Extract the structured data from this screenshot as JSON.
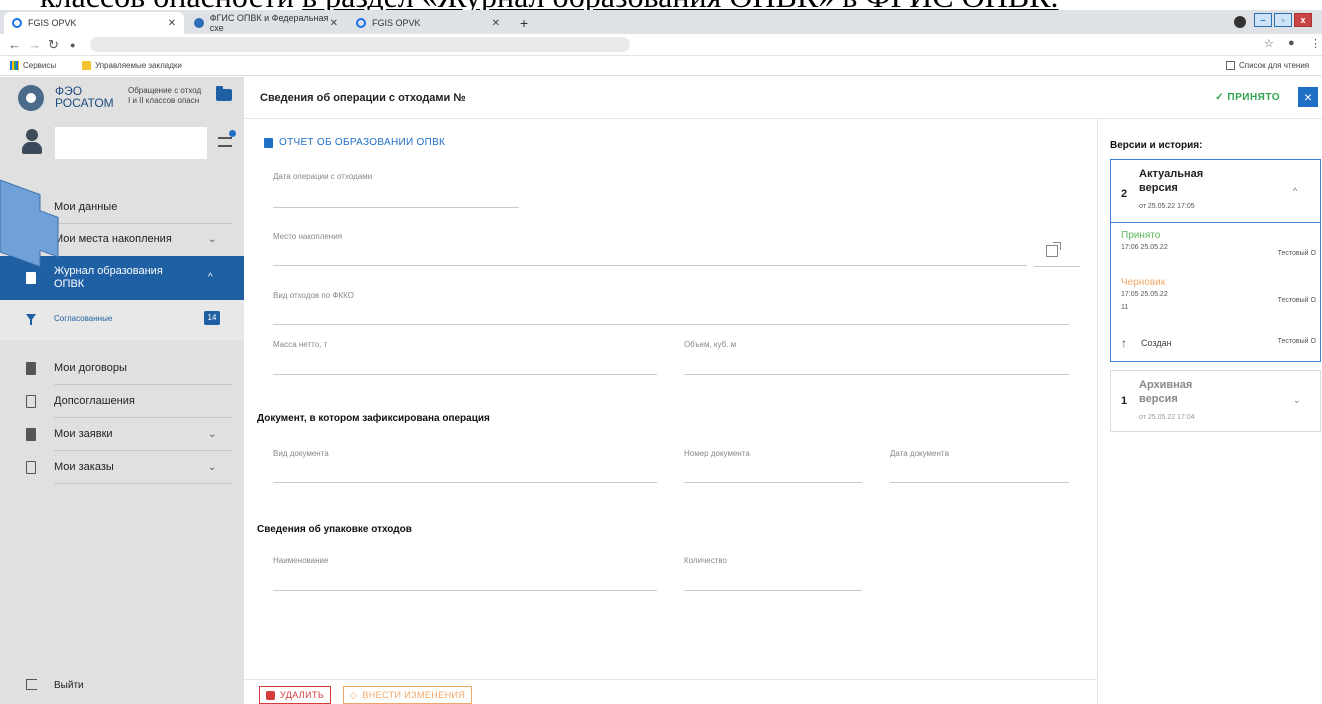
{
  "doc_text": {
    "plain": "классов опасности ",
    "underlined": "в раздел «Журнал образования ОПВК» в ФГИС ОПВК."
  },
  "browser": {
    "tabs": [
      {
        "label": "FGIS OPVK",
        "active": true
      },
      {
        "label": "ФГИС ОПВК и Федеральная схе",
        "active": false
      },
      {
        "label": "FGIS OPVK",
        "active": false
      }
    ],
    "new_tab": "+",
    "bookmarks": {
      "services": "Сервисы",
      "managed": "Управляемые закладки",
      "reading_list": "Список для чтения"
    }
  },
  "header": {
    "org_name_line1": "ФЭО",
    "org_name_line2": "РОСАТОМ",
    "org_desc_line1": "Обращение с отход",
    "org_desc_line2": "I и II классов опасн",
    "title": "Сведения об операции с отходами №",
    "status": "ПРИНЯТО",
    "close": "×"
  },
  "sidebar": {
    "items": [
      {
        "label": "Мои данные"
      },
      {
        "label": "Мои места накопления",
        "chevron": "⌄"
      },
      {
        "label": "Журнал образования ОПВК",
        "line1": "Журнал образования",
        "line2": "ОПВК",
        "chevron": "^"
      },
      {
        "label": "Согласованные",
        "badge": "14"
      },
      {
        "label": "Мои договоры"
      },
      {
        "label": "Допсоглашения"
      },
      {
        "label": "Мои заявки",
        "chevron": "⌄"
      },
      {
        "label": "Мои заказы",
        "chevron": "⌄"
      }
    ],
    "logout": "Выйти"
  },
  "form": {
    "report_link": "ОТЧЕТ ОБ ОБРАЗОВАНИИ ОПВК",
    "fields": {
      "operation_date": "Дата операции с отходами",
      "storage_place": "Место накопления",
      "waste_type": "Вид отходов по ФККО",
      "net_mass": "Масса нетто, т",
      "volume": "Объем, куб. м",
      "doc_type": "Вид документа",
      "doc_number": "Номер документа",
      "doc_date": "Дата документа",
      "package_name": "Наименование",
      "quantity": "Количество"
    },
    "sections": {
      "document": "Документ, в котором зафиксирована операция",
      "packaging": "Сведения об упаковке отходов"
    },
    "buttons": {
      "delete": "УДАЛИТЬ",
      "edit": "ВНЕСТИ ИЗМЕНЕНИЯ"
    }
  },
  "versions": {
    "title": "Версии и история:",
    "current": {
      "number": "2",
      "name_line1": "Актуальная",
      "name_line2": "версия",
      "date": "от 25.05.22 17:05",
      "history": [
        {
          "status": "Принято",
          "color": "#5cb85c",
          "time": "17:06 25.05.22",
          "user": "Тестовый О"
        },
        {
          "status": "Черновик",
          "color": "#f0a868",
          "time": "17:05 25.05.22",
          "user": "Тестовый О",
          "extra": "11"
        }
      ],
      "created": "Создан",
      "created_user": "Тестовый О"
    },
    "archive": {
      "number": "1",
      "name_line1": "Архивная",
      "name_line2": "версия",
      "date": "от 25.05.22 17:04"
    }
  }
}
